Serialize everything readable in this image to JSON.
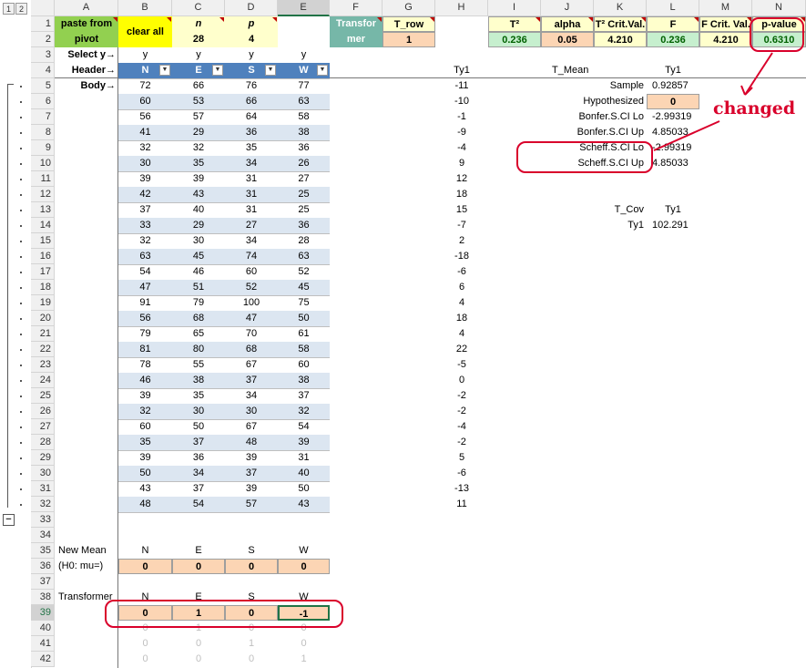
{
  "outline_buttons": [
    "1",
    "2"
  ],
  "collapse_symbol": "−",
  "columns": [
    "A",
    "B",
    "C",
    "D",
    "E",
    "F",
    "G",
    "H",
    "I",
    "J",
    "K",
    "L",
    "M",
    "N"
  ],
  "rows": [
    "1",
    "2",
    "3",
    "4",
    "5",
    "6",
    "7",
    "8",
    "9",
    "10",
    "11",
    "12",
    "13",
    "14",
    "15",
    "16",
    "17",
    "18",
    "19",
    "20",
    "21",
    "22",
    "23",
    "24",
    "25",
    "26",
    "27",
    "28",
    "29",
    "30",
    "31",
    "32",
    "33",
    "34",
    "35",
    "36",
    "37",
    "38",
    "39",
    "40",
    "41",
    "42"
  ],
  "top": {
    "paste_from_pivot": [
      "paste from",
      "pivot"
    ],
    "clear_all": "clear all",
    "n_label": "n",
    "n_value": "28",
    "p_label": "p",
    "p_value": "4",
    "transformer": [
      "Transfor",
      "mer"
    ],
    "t_row_label": "T_row",
    "t_row_value": "1",
    "t2_label": "T²",
    "t2_value": "0.236",
    "alpha_label": "alpha",
    "alpha_value": "0.05",
    "t2crit_label": "T² Crit.Val.",
    "t2crit_value": "4.210",
    "f_label": "F",
    "f_value": "0.236",
    "fcrit_label": "F Crit. Val.",
    "fcrit_value": "4.210",
    "pvalue_label": "p-value",
    "pvalue_value": "0.6310"
  },
  "labels": {
    "select_y": "Select y→",
    "header": "Header→",
    "body": "Body→",
    "new_mean": "New Mean",
    "h0": "(H0: mu=)",
    "transformer": "Transformer",
    "ty1": "Ty1"
  },
  "select_y": [
    "y",
    "y",
    "y",
    "y"
  ],
  "headers": [
    "N",
    "E",
    "S",
    "W"
  ],
  "body": [
    [
      "72",
      "66",
      "76",
      "77"
    ],
    [
      "60",
      "53",
      "66",
      "63"
    ],
    [
      "56",
      "57",
      "64",
      "58"
    ],
    [
      "41",
      "29",
      "36",
      "38"
    ],
    [
      "32",
      "32",
      "35",
      "36"
    ],
    [
      "30",
      "35",
      "34",
      "26"
    ],
    [
      "39",
      "39",
      "31",
      "27"
    ],
    [
      "42",
      "43",
      "31",
      "25"
    ],
    [
      "37",
      "40",
      "31",
      "25"
    ],
    [
      "33",
      "29",
      "27",
      "36"
    ],
    [
      "32",
      "30",
      "34",
      "28"
    ],
    [
      "63",
      "45",
      "74",
      "63"
    ],
    [
      "54",
      "46",
      "60",
      "52"
    ],
    [
      "47",
      "51",
      "52",
      "45"
    ],
    [
      "91",
      "79",
      "100",
      "75"
    ],
    [
      "56",
      "68",
      "47",
      "50"
    ],
    [
      "79",
      "65",
      "70",
      "61"
    ],
    [
      "81",
      "80",
      "68",
      "58"
    ],
    [
      "78",
      "55",
      "67",
      "60"
    ],
    [
      "46",
      "38",
      "37",
      "38"
    ],
    [
      "39",
      "35",
      "34",
      "37"
    ],
    [
      "32",
      "30",
      "30",
      "32"
    ],
    [
      "60",
      "50",
      "67",
      "54"
    ],
    [
      "35",
      "37",
      "48",
      "39"
    ],
    [
      "39",
      "36",
      "39",
      "31"
    ],
    [
      "50",
      "34",
      "37",
      "40"
    ],
    [
      "43",
      "37",
      "39",
      "50"
    ],
    [
      "48",
      "54",
      "57",
      "43"
    ]
  ],
  "ty1": [
    "-11",
    "-10",
    "-1",
    "-9",
    "-4",
    "9",
    "12",
    "18",
    "15",
    "-7",
    "2",
    "-18",
    "-6",
    "6",
    "4",
    "18",
    "4",
    "22",
    "-5",
    "0",
    "-2",
    "-2",
    "-4",
    "-2",
    "5",
    "-6",
    "-13",
    "11"
  ],
  "t_mean": {
    "title": "T_Mean",
    "col": "Ty1",
    "rows": [
      {
        "label": "Sample",
        "value": "0.92857"
      },
      {
        "label": "Hypothesized",
        "value": "0"
      },
      {
        "label": "Bonfer.S.CI Lo",
        "value": "-2.99319"
      },
      {
        "label": "Bonfer.S.CI Up",
        "value": "4.85033"
      },
      {
        "label": "Scheff.S.CI Lo",
        "value": "-2.99319"
      },
      {
        "label": "Scheff.S.CI Up",
        "value": "4.85033"
      }
    ]
  },
  "t_cov": {
    "title": "T_Cov",
    "col": "Ty1",
    "row_label": "Ty1",
    "value": "102.291"
  },
  "new_mean_headers": [
    "N",
    "E",
    "S",
    "W"
  ],
  "new_mean_values": [
    "0",
    "0",
    "0",
    "0"
  ],
  "transformer_headers": [
    "N",
    "E",
    "S",
    "W"
  ],
  "transformer_rows": [
    [
      "0",
      "1",
      "0",
      "-1"
    ],
    [
      "0",
      "1",
      "0",
      "0"
    ],
    [
      "0",
      "0",
      "1",
      "0"
    ],
    [
      "0",
      "0",
      "0",
      "1"
    ]
  ],
  "annotation": "changed",
  "colors": {
    "annotation": "#d9002b",
    "header_blue": "#4f81bd",
    "band": "#dce6f1",
    "orange": "#fcd5b4"
  }
}
